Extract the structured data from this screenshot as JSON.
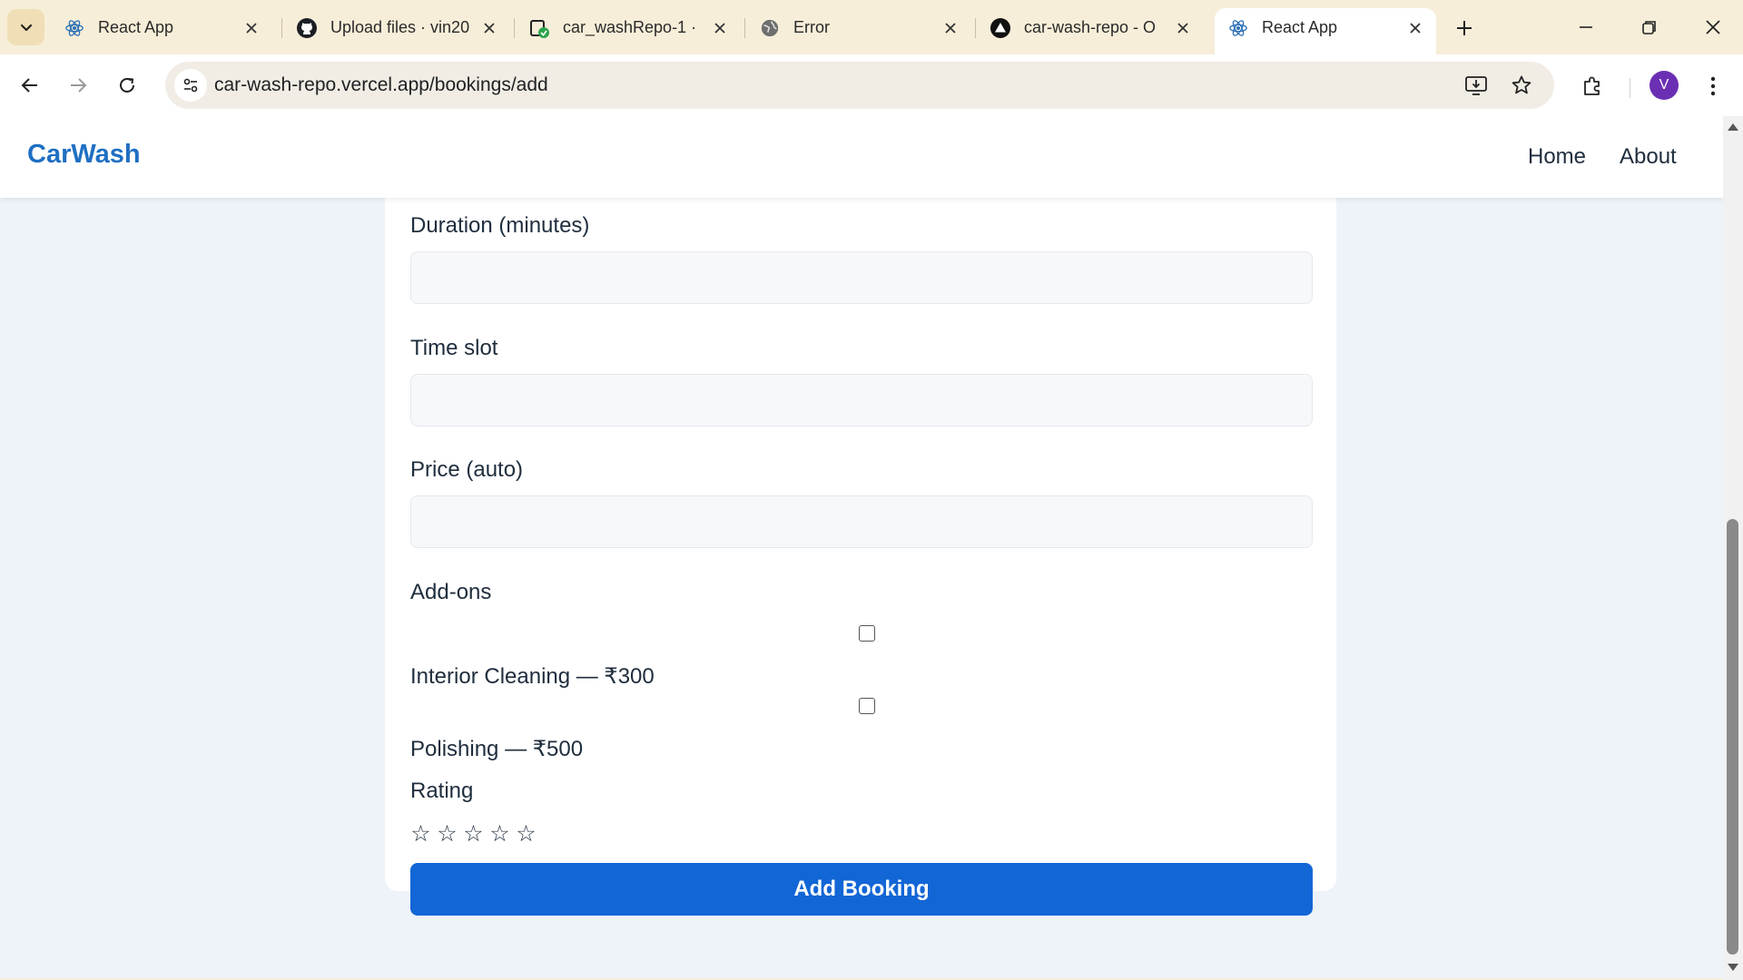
{
  "browser": {
    "tabs": [
      {
        "title": "React App",
        "icon": "react-icon",
        "active": false
      },
      {
        "title": "Upload files · vin20",
        "icon": "github-icon",
        "active": false
      },
      {
        "title": "car_washRepo-1 ·",
        "icon": "repo-icon",
        "active": false
      },
      {
        "title": "Error",
        "icon": "globe-icon",
        "active": false
      },
      {
        "title": "car-wash-repo - O",
        "icon": "vercel-icon",
        "active": false
      },
      {
        "title": "React App",
        "icon": "react-icon",
        "active": true
      }
    ],
    "url": "car-wash-repo.vercel.app/bookings/add",
    "profile_initial": "V"
  },
  "site": {
    "brand": "CarWash",
    "nav": {
      "home": "Home",
      "about": "About"
    }
  },
  "form": {
    "duration_label": "Duration (minutes)",
    "duration_value": "",
    "timeslot_label": "Time slot",
    "timeslot_value": "",
    "price_label": "Price (auto)",
    "price_value": "",
    "addons_label": "Add-ons",
    "addons": [
      {
        "label": "Interior Cleaning — ₹300",
        "checked": false
      },
      {
        "label": "Polishing — ₹500",
        "checked": false
      }
    ],
    "rating_label": "Rating",
    "rating_value": 0,
    "rating_max": 5,
    "star_glyph": "☆",
    "submit_label": "Add Booking"
  },
  "colors": {
    "brand": "#1f6fc2",
    "button": "#1266d6",
    "page_bg": "#eef3f9",
    "tabbar_bg": "#f7eed9"
  }
}
